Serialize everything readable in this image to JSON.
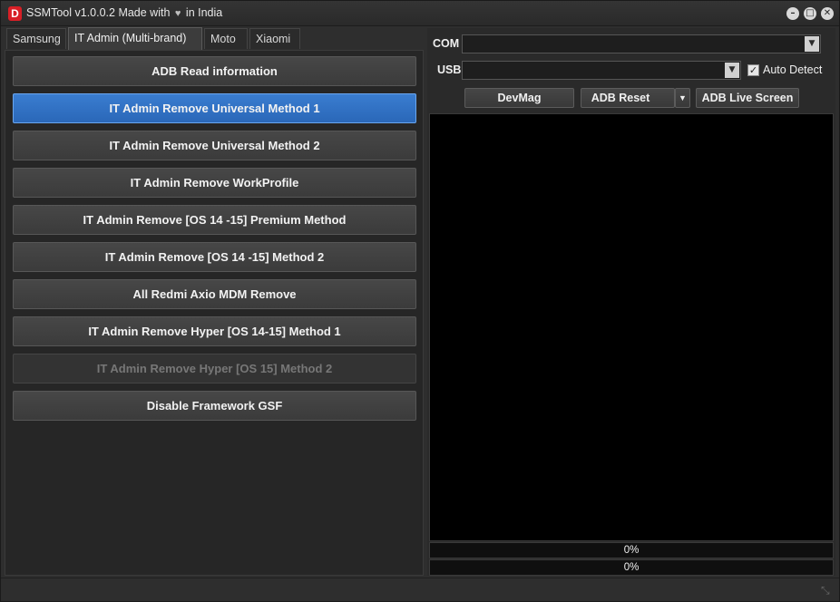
{
  "window": {
    "title_prefix": "SSMTool v1.0.0.2 Made with",
    "title_suffix": "in India",
    "heart_icon": "heart-icon",
    "logo_letter": "D",
    "logo_color": "#d81f26",
    "controls": {
      "minimize": "–",
      "maximize": "□",
      "close": "✕"
    }
  },
  "tabs": [
    {
      "label": "Samsung",
      "active": false
    },
    {
      "label": "IT Admin (Multi-brand)",
      "active": true
    },
    {
      "label": "Moto",
      "active": false
    },
    {
      "label": "Xiaomi",
      "active": false
    }
  ],
  "actions": [
    {
      "label": "ADB Read information",
      "state": "normal"
    },
    {
      "label": "IT Admin Remove Universal Method 1",
      "state": "active"
    },
    {
      "label": "IT Admin Remove Universal Method 2",
      "state": "normal"
    },
    {
      "label": "IT Admin Remove WorkProfile",
      "state": "normal"
    },
    {
      "label": "IT Admin Remove [OS 14 -15] Premium Method",
      "state": "normal"
    },
    {
      "label": "IT Admin Remove [OS 14 -15] Method 2",
      "state": "normal"
    },
    {
      "label": "All Redmi Axio MDM Remove",
      "state": "normal"
    },
    {
      "label": "IT Admin Remove Hyper [OS 14-15] Method 1",
      "state": "normal"
    },
    {
      "label": "IT Admin Remove Hyper [OS 15] Method 2",
      "state": "disabled"
    },
    {
      "label": "Disable Framework GSF",
      "state": "normal"
    }
  ],
  "connection": {
    "com_label": "COM",
    "com_value": "",
    "usb_label": "USB",
    "usb_value": "",
    "auto_detect_label": "Auto Detect",
    "auto_detect_checked": true
  },
  "tools": {
    "devmag": "DevMag",
    "adb_reset": "ADB Reset",
    "adb_live_screen": "ADB Live Screen"
  },
  "progress": [
    {
      "text": "0%",
      "value": 0
    },
    {
      "text": "0%",
      "value": 0
    }
  ],
  "colors": {
    "accent": "#2a67b8",
    "background": "#2e2e2e",
    "screen": "#000000"
  }
}
